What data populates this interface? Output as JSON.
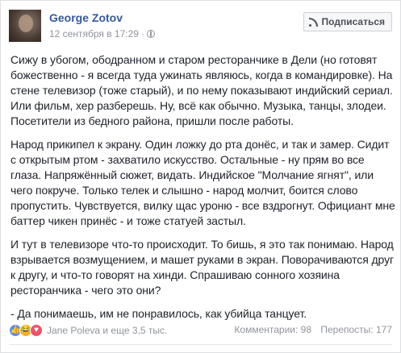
{
  "author": {
    "name": "George Zotov",
    "timestamp": "12 сентября в 17:29",
    "separator": "·",
    "privacy_icon": "globe-icon"
  },
  "header": {
    "subscribe_label": "Подписаться",
    "subscribe_icon": "rss-icon"
  },
  "post": {
    "paragraphs": [
      "Сижу в убогом, ободранном и старом ресторанчике в Дели (но готовят божественно - я всегда туда ужинать являюсь, когда в командировке). На стене телевизор (тоже старый), и по нему показывают индийский сериал. Или фильм, хер разберешь. Ну, всё как обычно. Музыка, танцы, злодеи. Посетители из бедного района, пришли после работы.",
      "Народ прикипел к экрану. Один ложку до рта донёс, и так и замер. Сидит с открытым ртом - захватило искусство. Остальные - ну прям во все глаза. Напряжённый сюжет, видать. Индийское \"Молчание ягнят\", или чего покруче. Только телек и слышно - народ молчит, боится слово пропустить. Чувствуется, вилку щас уроню - все вздрогнут. Официант мне баттер чикен принёс - и тоже статуей застыл.",
      "И тут в телевизоре что-то происходит. То бишь, я это так понимаю. Народ взрывается возмущением, и машет руками в экран. Поворачиваются друг к другу, и что-то говорят на хинди. Спрашиваю сонного хозяина ресторанчика - чего это они?",
      "- Да понимаешь, им не понравилось, как убийца танцует."
    ]
  },
  "footer": {
    "reaction_icons": [
      "like-icon",
      "haha-icon",
      "love-icon"
    ],
    "likers": "Jane Poleva и еще 3,5 тыс.",
    "comments": "Комментарии: 98",
    "shares": "Перепосты: 177"
  },
  "colors": {
    "link": "#365899",
    "meta": "#90949c",
    "text": "#1d2129",
    "like": "#5890ff",
    "haha": "#f7b125",
    "love": "#f25268"
  }
}
